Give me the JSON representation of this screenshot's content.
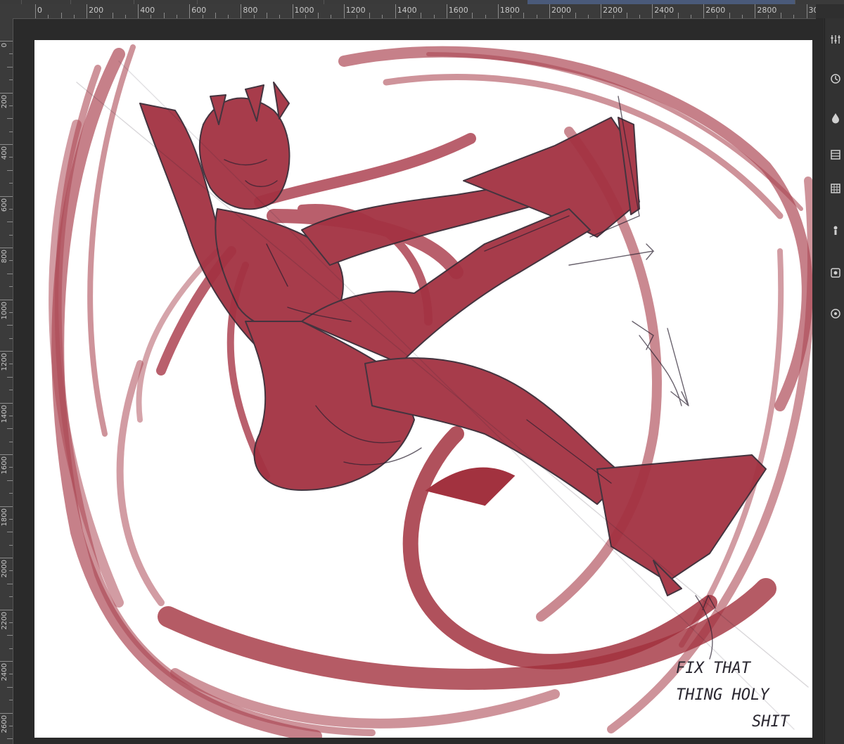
{
  "ruler": {
    "horizontal_labels": [
      "0",
      "200",
      "400",
      "600",
      "800",
      "1000",
      "1200",
      "1400",
      "1600",
      "1800",
      "2000",
      "2200",
      "2400",
      "2600",
      "2800",
      "30"
    ],
    "vertical_labels": [
      "0",
      "200",
      "400",
      "600",
      "800",
      "1000",
      "1200",
      "1400",
      "1600",
      "1800",
      "2000",
      "2200",
      "2400",
      "2600"
    ]
  },
  "dock": {
    "icons": [
      "sliders-icon",
      "history-icon",
      "color-drop-icon",
      "layers-icon",
      "grid-icon",
      "brush-preset-icon",
      "transform-icon",
      "overview-icon"
    ]
  },
  "canvas": {
    "annotation_line1": "FIX THAT",
    "annotation_line2": "THING HOLY",
    "annotation_line3": "SHIT"
  },
  "colors": {
    "ink_red": "#9e2a38",
    "ink_dark": "#3a2a35",
    "paper": "#ffffff",
    "ui_dark": "#2f2f2f"
  }
}
